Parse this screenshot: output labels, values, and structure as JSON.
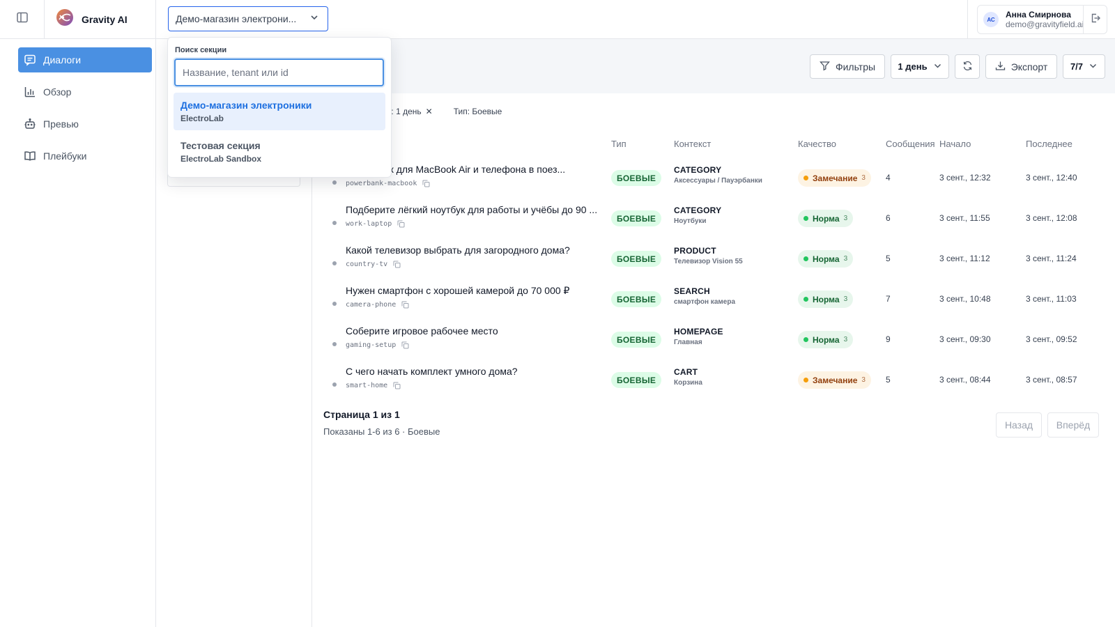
{
  "app": {
    "name": "Gravity AI"
  },
  "header": {
    "section_value": "Демо-магазин электрони...",
    "user": {
      "initials": "АС",
      "name": "Анна Смирнова",
      "email": "demo@gravityfield.ai"
    }
  },
  "sidebar": {
    "items": [
      {
        "label": "Диалоги",
        "icon": "chat-icon",
        "active": true
      },
      {
        "label": "Обзор",
        "icon": "bar-chart-icon",
        "active": false
      },
      {
        "label": "Превью",
        "icon": "bot-icon",
        "active": false
      },
      {
        "label": "Плейбуки",
        "icon": "book-icon",
        "active": false
      }
    ]
  },
  "toolbar": {
    "filters_label": "Фильтры",
    "period_label": "1 день",
    "export_label": "Экспорт",
    "columns_label": "7/7"
  },
  "chips": {
    "period": "од: 1 день",
    "type": "Тип: Боевые"
  },
  "table": {
    "headers": {
      "type": "Тип",
      "context": "Контекст",
      "quality": "Качество",
      "messages": "Сообщения",
      "start": "Начало",
      "last": "Последнее"
    },
    "rows": [
      {
        "title": "Пауэрбанк для MacBook Air и телефона в поез...",
        "slug": "powerbank-macbook",
        "type": "БОЕВЫЕ",
        "context_type": "CATEGORY",
        "context_sub": "Аксессуары / Пауэрбанки",
        "quality": "Замечание",
        "quality_count": "3",
        "quality_status": "warn",
        "messages": "4",
        "start": "3 сент., 12:32",
        "last": "3 сент., 12:40"
      },
      {
        "title": "Подберите лёгкий ноутбук для работы и учёбы до 90 ...",
        "slug": "work-laptop",
        "type": "БОЕВЫЕ",
        "context_type": "CATEGORY",
        "context_sub": "Ноутбуки",
        "quality": "Норма",
        "quality_count": "3",
        "quality_status": "ok",
        "messages": "6",
        "start": "3 сент., 11:55",
        "last": "3 сент., 12:08"
      },
      {
        "title": "Какой телевизор выбрать для загородного дома?",
        "slug": "country-tv",
        "type": "БОЕВЫЕ",
        "context_type": "PRODUCT",
        "context_sub": "Телевизор Vision 55",
        "quality": "Норма",
        "quality_count": "3",
        "quality_status": "ok",
        "messages": "5",
        "start": "3 сент., 11:12",
        "last": "3 сент., 11:24"
      },
      {
        "title": "Нужен смартфон с хорошей камерой до 70 000 ₽",
        "slug": "camera-phone",
        "type": "БОЕВЫЕ",
        "context_type": "SEARCH",
        "context_sub": "смартфон камера",
        "quality": "Норма",
        "quality_count": "3",
        "quality_status": "ok",
        "messages": "7",
        "start": "3 сент., 10:48",
        "last": "3 сент., 11:03"
      },
      {
        "title": "Соберите игровое рабочее место",
        "slug": "gaming-setup",
        "type": "БОЕВЫЕ",
        "context_type": "HOMEPAGE",
        "context_sub": "Главная",
        "quality": "Норма",
        "quality_count": "3",
        "quality_status": "ok",
        "messages": "9",
        "start": "3 сент., 09:30",
        "last": "3 сент., 09:52"
      },
      {
        "title": "С чего начать комплект умного дома?",
        "slug": "smart-home",
        "type": "БОЕВЫЕ",
        "context_type": "CART",
        "context_sub": "Корзина",
        "quality": "Замечание",
        "quality_count": "3",
        "quality_status": "warn",
        "messages": "5",
        "start": "3 сент., 08:44",
        "last": "3 сент., 08:57"
      }
    ]
  },
  "pagination": {
    "title": "Страница 1 из 1",
    "summary": "Показаны 1-6 из 6 · Боевые",
    "prev_label": "Назад",
    "next_label": "Вперёд"
  },
  "dropdown": {
    "label": "Поиск секции",
    "placeholder": "Название, tenant или id",
    "options": [
      {
        "name": "Демо-магазин электроники",
        "tenant": "ElectroLab",
        "selected": true
      },
      {
        "name": "Тестовая секция",
        "tenant": "ElectroLab Sandbox",
        "selected": false
      }
    ]
  },
  "colors": {
    "accent": "#4a90e2",
    "selected_text": "#1d6fe0",
    "warn": "#f59e0b",
    "ok": "#22c55e"
  }
}
